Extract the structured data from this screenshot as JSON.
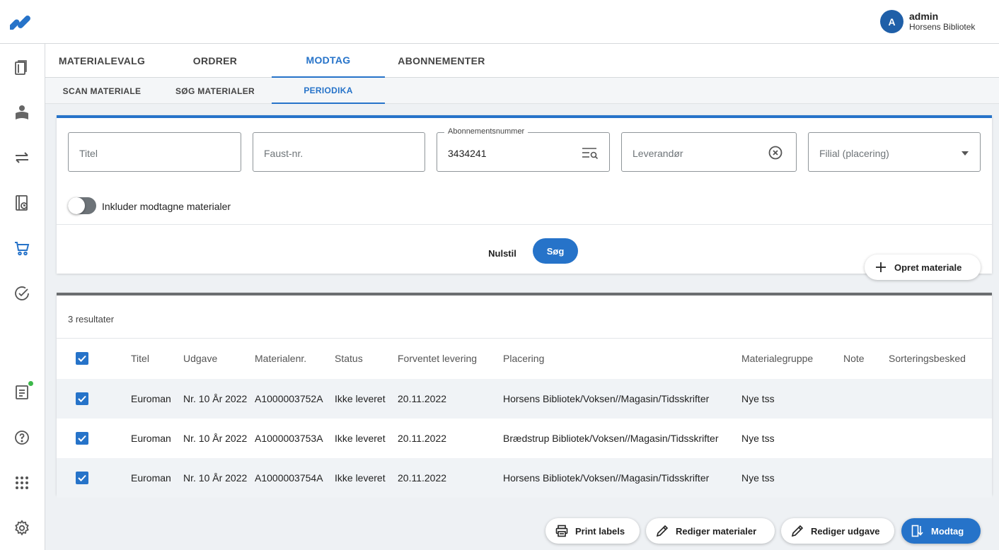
{
  "header": {
    "user": {
      "initial": "A",
      "name": "admin",
      "org": "Horsens Bibliotek"
    }
  },
  "rail": {
    "items": [
      "books-icon",
      "reader-icon",
      "transfer-icon",
      "loan-history-icon",
      "cart-icon",
      "check-circle-icon",
      "report-icon",
      "help-icon",
      "apps-grid-icon",
      "settings-icon"
    ]
  },
  "tabs": [
    "MATERIALEVALG",
    "ORDRER",
    "MODTAG",
    "ABONNEMENTER"
  ],
  "subtabs": [
    "SCAN MATERIALE",
    "SØG MATERIALER",
    "PERIODIKA"
  ],
  "filters": {
    "titel_placeholder": "Titel",
    "faust_placeholder": "Faust-nr.",
    "abonnement_label": "Abonnementsnummer",
    "abonnement_value": "3434241",
    "leverandor_placeholder": "Leverandør",
    "filial_placeholder": "Filial (placering)",
    "toggle_label": "Inkluder modtagne materialer",
    "toggle_on": false,
    "reset_label": "Nulstil",
    "search_label": "Søg"
  },
  "actions": {
    "create_label": "Opret materiale",
    "print_label": "Print labels",
    "edit_materials_label": "Rediger materialer",
    "edit_issue_label": "Rediger udgave",
    "receive_label": "Modtag"
  },
  "results": {
    "count_label": "3 resultater",
    "columns": [
      "Titel",
      "Udgave",
      "Materialenr.",
      "Status",
      "Forventet levering",
      "Placering",
      "Materialegruppe",
      "Note",
      "Sorteringsbesked"
    ],
    "rows": [
      {
        "checked": true,
        "titel": "Euroman",
        "udgave": "Nr. 10 År 2022",
        "materialenr": "A1000003752A",
        "status": "Ikke leveret",
        "levering": "20.11.2022",
        "placering": "Horsens Bibliotek/Voksen//Magasin/Tidsskrifter",
        "gruppe": "Nye tss",
        "note": "",
        "sortering": ""
      },
      {
        "checked": true,
        "titel": "Euroman",
        "udgave": "Nr. 10 År 2022",
        "materialenr": "A1000003753A",
        "status": "Ikke leveret",
        "levering": "20.11.2022",
        "placering": "Brædstrup Bibliotek/Voksen//Magasin/Tidsskrifter",
        "gruppe": "Nye tss",
        "note": "",
        "sortering": ""
      },
      {
        "checked": true,
        "titel": "Euroman",
        "udgave": "Nr. 10 År 2022",
        "materialenr": "A1000003754A",
        "status": "Ikke leveret",
        "levering": "20.11.2022",
        "placering": "Horsens Bibliotek/Voksen//Magasin/Tidsskrifter",
        "gruppe": "Nye tss",
        "note": "",
        "sortering": ""
      }
    ]
  },
  "colors": {
    "accent": "#2673c9",
    "rail_dot": "#3cb84a"
  }
}
